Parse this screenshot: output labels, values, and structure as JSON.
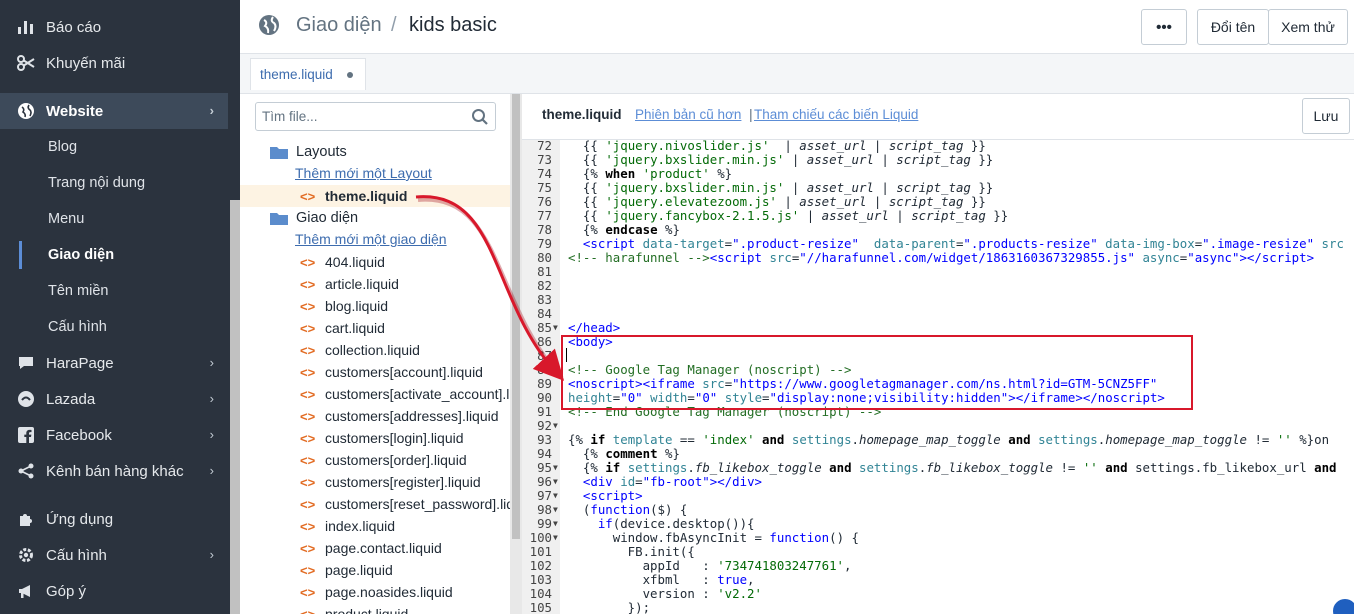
{
  "sidebar": {
    "items": [
      {
        "label": "Báo cáo",
        "icon": "bar-chart-icon"
      },
      {
        "label": "Khuyến mãi",
        "icon": "scissors-icon"
      },
      {
        "label": "Website",
        "icon": "globe-icon"
      },
      {
        "label": "HaraPage",
        "icon": "chat-bubble-icon"
      },
      {
        "label": "Lazada",
        "icon": "lazada-icon"
      },
      {
        "label": "Facebook",
        "icon": "facebook-icon"
      },
      {
        "label": "Kênh bán hàng khác",
        "icon": "share-icon"
      },
      {
        "label": "Ứng dụng",
        "icon": "puzzle-icon"
      },
      {
        "label": "Cấu hình",
        "icon": "gear-icon"
      },
      {
        "label": "Góp ý",
        "icon": "megaphone-icon"
      }
    ],
    "website_sub": [
      "Blog",
      "Trang nội dung",
      "Menu",
      "Giao diện",
      "Tên miền",
      "Cấu hình"
    ]
  },
  "header": {
    "section": "Giao diện",
    "separator": "/",
    "theme": "kids basic",
    "more_label": "•••",
    "rename_label": "Đổi tên",
    "preview_label": "Xem thử"
  },
  "tab": {
    "label": "theme.liquid"
  },
  "files": {
    "search_placeholder": "Tìm file...",
    "layouts_label": "Layouts",
    "add_layout": "Thêm mới một Layout",
    "selected_file": "theme.liquid",
    "templates_label": "Giao diện",
    "add_template": "Thêm mới một giao diện",
    "list": [
      "404.liquid",
      "article.liquid",
      "blog.liquid",
      "cart.liquid",
      "collection.liquid",
      "customers[account].liquid",
      "customers[activate_account].liquid",
      "customers[addresses].liquid",
      "customers[login].liquid",
      "customers[order].liquid",
      "customers[register].liquid",
      "customers[reset_password].liquid",
      "index.liquid",
      "page.contact.liquid",
      "page.liquid",
      "page.noasides.liquid",
      "product.liquid"
    ]
  },
  "editor": {
    "file_name": "theme.liquid",
    "old_versions": "Phiên bản cũ hơn",
    "separator": "|",
    "variables_ref": "Tham chiếu các biến Liquid",
    "save_label": "Lưu",
    "line_numbers": [
      "72",
      "73",
      "74",
      "75",
      "76",
      "77",
      "78",
      "79",
      "80",
      "81",
      "82",
      "83",
      "84",
      "85",
      "86",
      "87",
      "88",
      "89",
      "90",
      "91",
      "92",
      "93",
      "94",
      "95",
      "96",
      "97",
      "98",
      "99",
      "100",
      "101",
      "102",
      "103",
      "104",
      "105"
    ]
  },
  "colors": {
    "sidebar_bg": "#2b333e",
    "link": "#3d6cae",
    "highlight_border": "#d8182b",
    "arrow": "#d8182b"
  }
}
